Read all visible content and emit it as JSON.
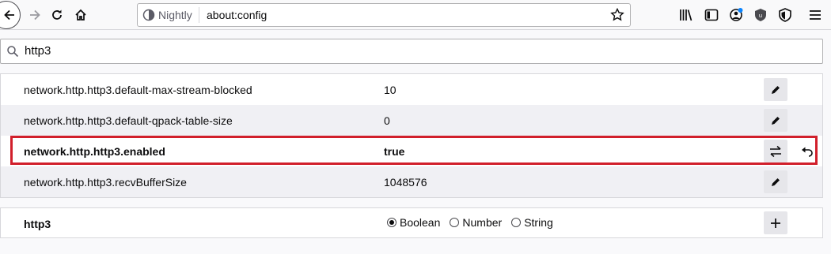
{
  "toolbar": {
    "browser_name": "Nightly",
    "url": "about:config"
  },
  "search": {
    "value": "http3"
  },
  "prefs": [
    {
      "name": "network.http.http3.default-max-stream-blocked",
      "value": "10",
      "action": "edit-icon",
      "modified": false
    },
    {
      "name": "network.http.http3.default-qpack-table-size",
      "value": "0",
      "action": "edit-icon",
      "modified": false
    },
    {
      "name": "network.http.http3.enabled",
      "value": "true",
      "action": "toggle-icon",
      "modified": true
    },
    {
      "name": "network.http.http3.recvBufferSize",
      "value": "1048576",
      "action": "edit-icon",
      "modified": false
    }
  ],
  "add_row": {
    "name": "http3",
    "types": [
      "Boolean",
      "Number",
      "String"
    ],
    "selected_type": "Boolean"
  },
  "colors": {
    "highlight": "#d11f2b",
    "accent": "#0a84ff"
  }
}
